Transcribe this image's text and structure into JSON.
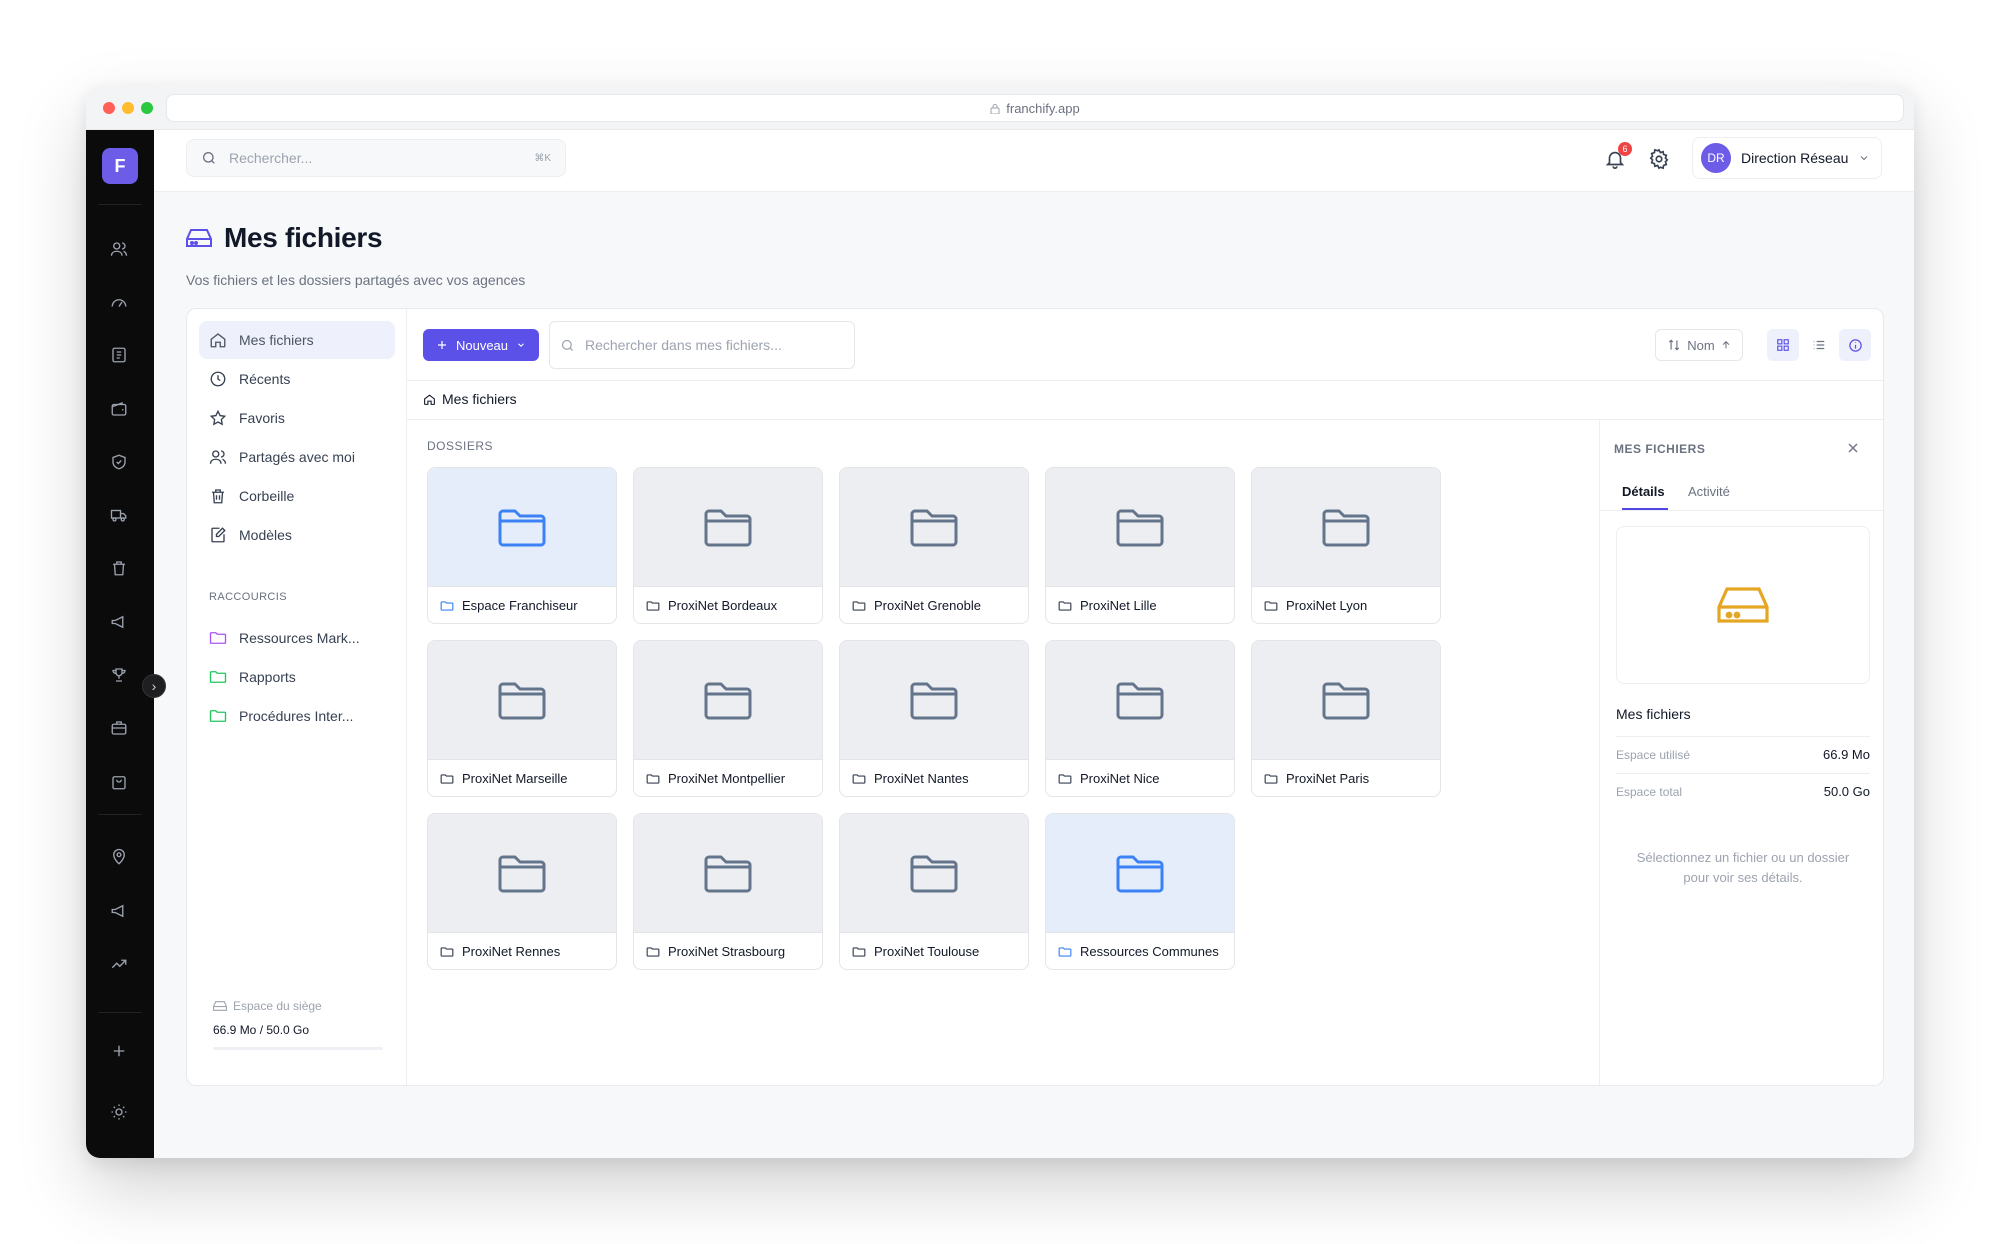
{
  "browser": {
    "url": "franchify.app"
  },
  "rail": {
    "logo_letter": "F",
    "toggle_glyph": "›"
  },
  "topbar": {
    "search_placeholder": "Rechercher...",
    "search_shortcut": "⌘K",
    "notification_count": "6",
    "user_initials": "DR",
    "user_name": "Direction Réseau"
  },
  "page": {
    "title": "Mes fichiers",
    "subtitle": "Vos fichiers et les dossiers partagés avec vos agences"
  },
  "sidebar": {
    "items": [
      {
        "label": "Mes fichiers",
        "icon": "home-icon",
        "active": true
      },
      {
        "label": "Récents",
        "icon": "clock-icon"
      },
      {
        "label": "Favoris",
        "icon": "star-icon"
      },
      {
        "label": "Partagés avec moi",
        "icon": "users-icon"
      },
      {
        "label": "Corbeille",
        "icon": "trash-icon"
      },
      {
        "label": "Modèles",
        "icon": "template-icon"
      }
    ],
    "shortcuts_label": "RACCOURCIS",
    "shortcuts": [
      {
        "label": "Ressources Mark...",
        "color": "#a855f7"
      },
      {
        "label": "Rapports",
        "color": "#22c55e"
      },
      {
        "label": "Procédures Inter...",
        "color": "#22c55e"
      }
    ],
    "storage_label": "Espace du siège",
    "storage_value": "66.9 Mo / 50.0 Go"
  },
  "toolbar": {
    "new_label": "Nouveau",
    "search_placeholder": "Rechercher dans mes fichiers...",
    "sort_label": "Nom"
  },
  "breadcrumb": "Mes fichiers",
  "section_label": "DOSSIERS",
  "folders": [
    {
      "name": "Espace Franchiseur",
      "highlight": true
    },
    {
      "name": "ProxiNet Bordeaux"
    },
    {
      "name": "ProxiNet Grenoble"
    },
    {
      "name": "ProxiNet Lille"
    },
    {
      "name": "ProxiNet Lyon"
    },
    {
      "name": "ProxiNet Marseille"
    },
    {
      "name": "ProxiNet Montpellier"
    },
    {
      "name": "ProxiNet Nantes"
    },
    {
      "name": "ProxiNet Nice"
    },
    {
      "name": "ProxiNet Paris"
    },
    {
      "name": "ProxiNet Rennes"
    },
    {
      "name": "ProxiNet Strasbourg"
    },
    {
      "name": "ProxiNet Toulouse"
    },
    {
      "name": "Ressources Communes",
      "highlight": true
    }
  ],
  "details": {
    "header": "MES FICHIERS",
    "tabs": [
      "Détails",
      "Activité"
    ],
    "title": "Mes fichiers",
    "rows": [
      {
        "key": "Espace utilisé",
        "value": "66.9 Mo"
      },
      {
        "key": "Espace total",
        "value": "50.0 Go"
      }
    ],
    "hint": "Sélectionnez un fichier ou un dossier pour voir ses détails."
  },
  "colors": {
    "accent": "#5b50e8",
    "rail_bg": "#0b0b0c",
    "drive_icon": "#e5a623",
    "folder_highlight": "#3b82f6"
  }
}
